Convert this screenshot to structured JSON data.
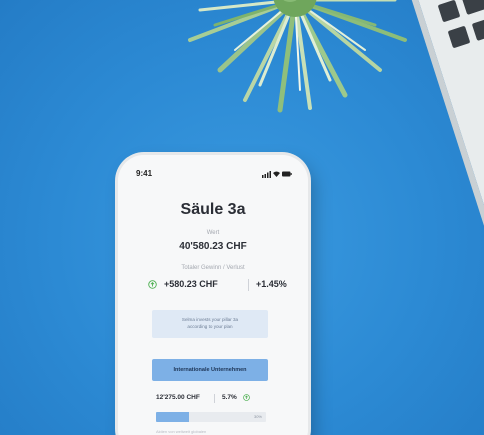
{
  "status_bar": {
    "time": "9:41"
  },
  "app": {
    "title": "Säule 3a",
    "value_label": "Wert",
    "value": "40'580.23 CHF",
    "gain_label": "Totaler Gewinn / Verlust",
    "gain_amount": "+580.23 CHF",
    "gain_percent": "+1.45%",
    "info_lines": [
      "Selma invests your pillar 3a",
      "according to your plan"
    ],
    "category_button": "Internationale Unternehmen",
    "detail_amount": "12'275.00 CHF",
    "detail_percent": "5.7%",
    "progress_fraction": 0.3,
    "progress_text": "30%",
    "bottom_text": "Aktien von weltweit globalen"
  },
  "colors": {
    "background": "#2f8fd8",
    "accent_blue": "#7db0e6",
    "gain_green": "#4caf50"
  },
  "icons": {
    "gain": "arrow-up-circle-icon",
    "detail": "arrow-up-circle-icon",
    "signal": "signal-icon",
    "wifi": "wifi-icon",
    "battery": "battery-icon"
  }
}
